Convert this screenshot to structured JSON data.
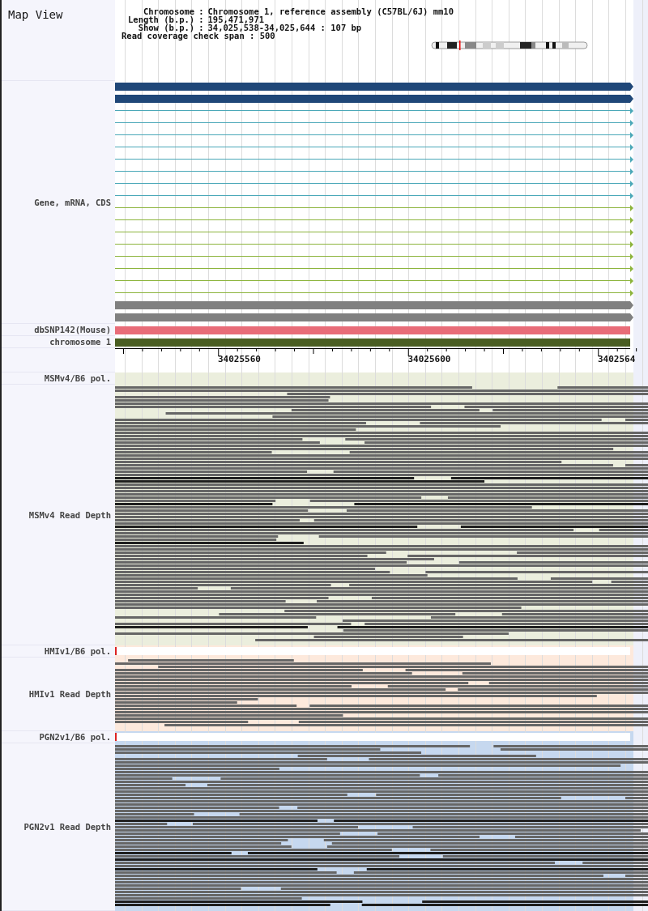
{
  "title": "Map View",
  "info": [
    {
      "label": "Chromosome",
      "sep": ":",
      "value": "Chromosome 1, reference assembly (C57BL/6J) mm10"
    },
    {
      "label": "Length (b.p.)",
      "sep": ":",
      "value": "195,471,971"
    },
    {
      "label": "Show (b.p.)",
      "sep": ":",
      "value": "34,025,538-34,025,644 : 107 bp"
    }
  ],
  "coverage": "Read coverage check span : 500",
  "gene_track": {
    "label": "Gene, mRNA, CDS",
    "features": [
      {
        "kind": "thick",
        "color": "#1f4778"
      },
      {
        "kind": "thick",
        "color": "#1f4778"
      },
      {
        "kind": "thin",
        "color": "#4aa8b8"
      },
      {
        "kind": "thin",
        "color": "#4aa8b8"
      },
      {
        "kind": "thin",
        "color": "#4aa8b8"
      },
      {
        "kind": "thin",
        "color": "#4aa8b8"
      },
      {
        "kind": "thin",
        "color": "#4aa8b8"
      },
      {
        "kind": "thin",
        "color": "#4aa8b8"
      },
      {
        "kind": "thin",
        "color": "#4aa8b8"
      },
      {
        "kind": "thin",
        "color": "#4aa8b8"
      },
      {
        "kind": "thin",
        "color": "#8cb43c"
      },
      {
        "kind": "thin",
        "color": "#8cb43c"
      },
      {
        "kind": "thin",
        "color": "#8cb43c"
      },
      {
        "kind": "thin",
        "color": "#8cb43c"
      },
      {
        "kind": "thin",
        "color": "#8cb43c"
      },
      {
        "kind": "thin",
        "color": "#8cb43c"
      },
      {
        "kind": "thin",
        "color": "#8cb43c"
      },
      {
        "kind": "thin",
        "color": "#8cb43c"
      },
      {
        "kind": "thick",
        "color": "#808080"
      },
      {
        "kind": "thick",
        "color": "#808080"
      }
    ]
  },
  "snp_track": {
    "label": "dbSNP142(Mouse)",
    "color": "#e86c78"
  },
  "chromosome_track": {
    "label": "chromosome 1",
    "color": "#4a5e22"
  },
  "axis": {
    "labels": [
      "34025560",
      "34025600",
      "3402564"
    ]
  },
  "strains": [
    {
      "pol_label": "MSMv4/B6 pol.",
      "depth_label": "MSMv4 Read Depth",
      "color": "#ebeedd",
      "pol_bar": false
    },
    {
      "pol_label": "HMIv1/B6 pol.",
      "depth_label": "HMIv1 Read Depth",
      "color": "#fde9dc",
      "pol_bar": true
    },
    {
      "pol_label": "PGN2v1/B6 pol.",
      "depth_label": "PGN2v1 Read Depth",
      "color": "#c6d8ef",
      "pol_bar": true
    }
  ]
}
